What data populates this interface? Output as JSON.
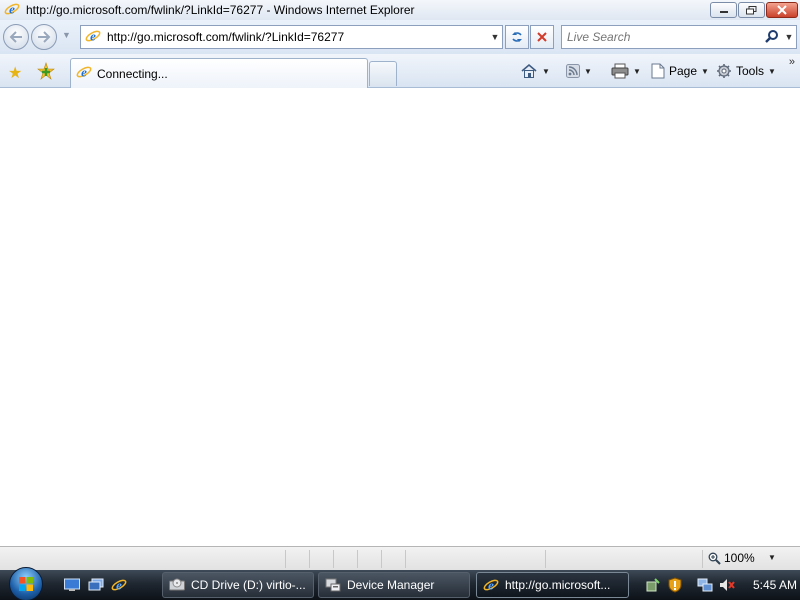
{
  "window": {
    "title": "http://go.microsoft.com/fwlink/?LinkId=76277 - Windows Internet Explorer",
    "buttons": {
      "minimize": "minimize",
      "maximize": "maximize",
      "close": "close"
    }
  },
  "address_bar": {
    "url": "http://go.microsoft.com/fwlink/?LinkId=76277"
  },
  "search": {
    "placeholder": "Live Search"
  },
  "tabs": [
    {
      "label": "Connecting...",
      "icon": "ie-icon",
      "active": true
    }
  ],
  "command_bar": {
    "home_icon": "home-icon",
    "feeds_icon": "feeds-icon",
    "print_icon": "print-icon",
    "page_label": "Page",
    "tools_label": "Tools"
  },
  "status_bar": {
    "zoom": "100%"
  },
  "taskbar": {
    "buttons": [
      {
        "label": "CD Drive (D:) virtio-...",
        "icon": "cd-drive-icon"
      },
      {
        "label": "Device Manager",
        "icon": "device-manager-icon"
      },
      {
        "label": "http://go.microsoft...",
        "icon": "ie-icon",
        "active": true
      }
    ],
    "clock": "5:45 AM"
  },
  "colors": {
    "ie_blue": "#1f6fd1",
    "ie_ring": "#f0b52a",
    "taskbar_dark": "#1f2731",
    "chrome_light": "#dae5f3"
  }
}
